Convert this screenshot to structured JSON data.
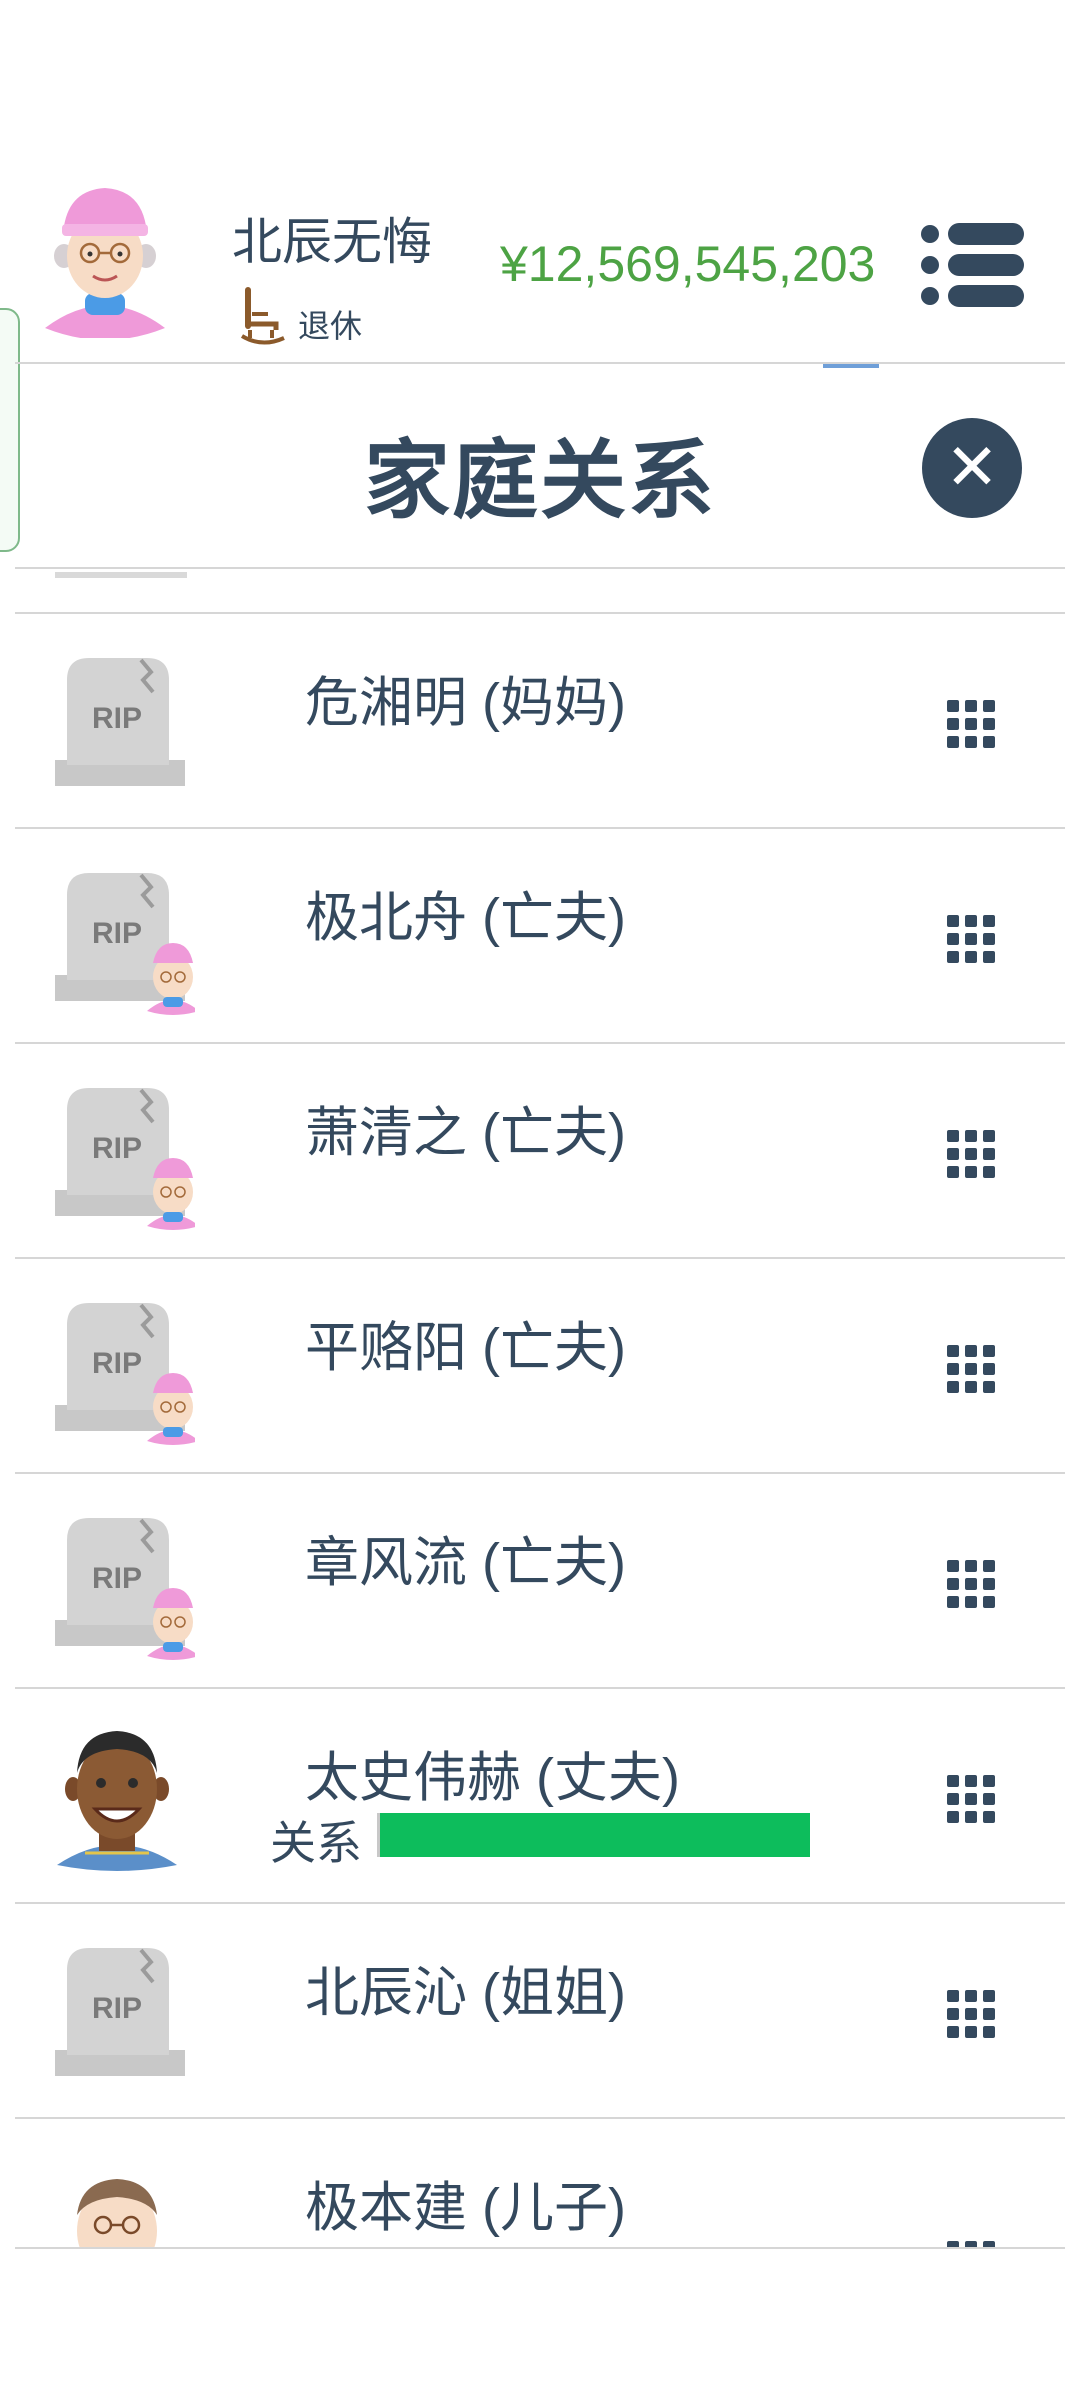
{
  "player": {
    "name": "北辰无悔",
    "status": "退休",
    "money": "¥12,569,545,203"
  },
  "colors": {
    "money": "#4da344",
    "text": "#34495e",
    "relationship_bar": "#0dbd5c"
  },
  "panel": {
    "title": "家庭关系",
    "close_icon": "close-icon"
  },
  "relations": [
    {
      "name": "危湘明 (妈妈)",
      "avatar": "rip-tombstone",
      "deceased": true
    },
    {
      "name": "极北舟 (亡夫)",
      "avatar": "rip-tombstone-with-player",
      "deceased": true
    },
    {
      "name": "萧清之 (亡夫)",
      "avatar": "rip-tombstone-with-player",
      "deceased": true
    },
    {
      "name": "平赂阳 (亡夫)",
      "avatar": "rip-tombstone-with-player",
      "deceased": true
    },
    {
      "name": "章风流 (亡夫)",
      "avatar": "rip-tombstone-with-player",
      "deceased": true
    },
    {
      "name": "太史伟赫 (丈夫)",
      "avatar": "husband-avatar",
      "deceased": false,
      "relationship_label": "关系",
      "relationship_level": 1.0
    },
    {
      "name": "北辰沁 (姐姐)",
      "avatar": "rip-tombstone",
      "deceased": true
    },
    {
      "name": "极本建 (儿子)",
      "avatar": "son-avatar",
      "deceased": false
    }
  ]
}
